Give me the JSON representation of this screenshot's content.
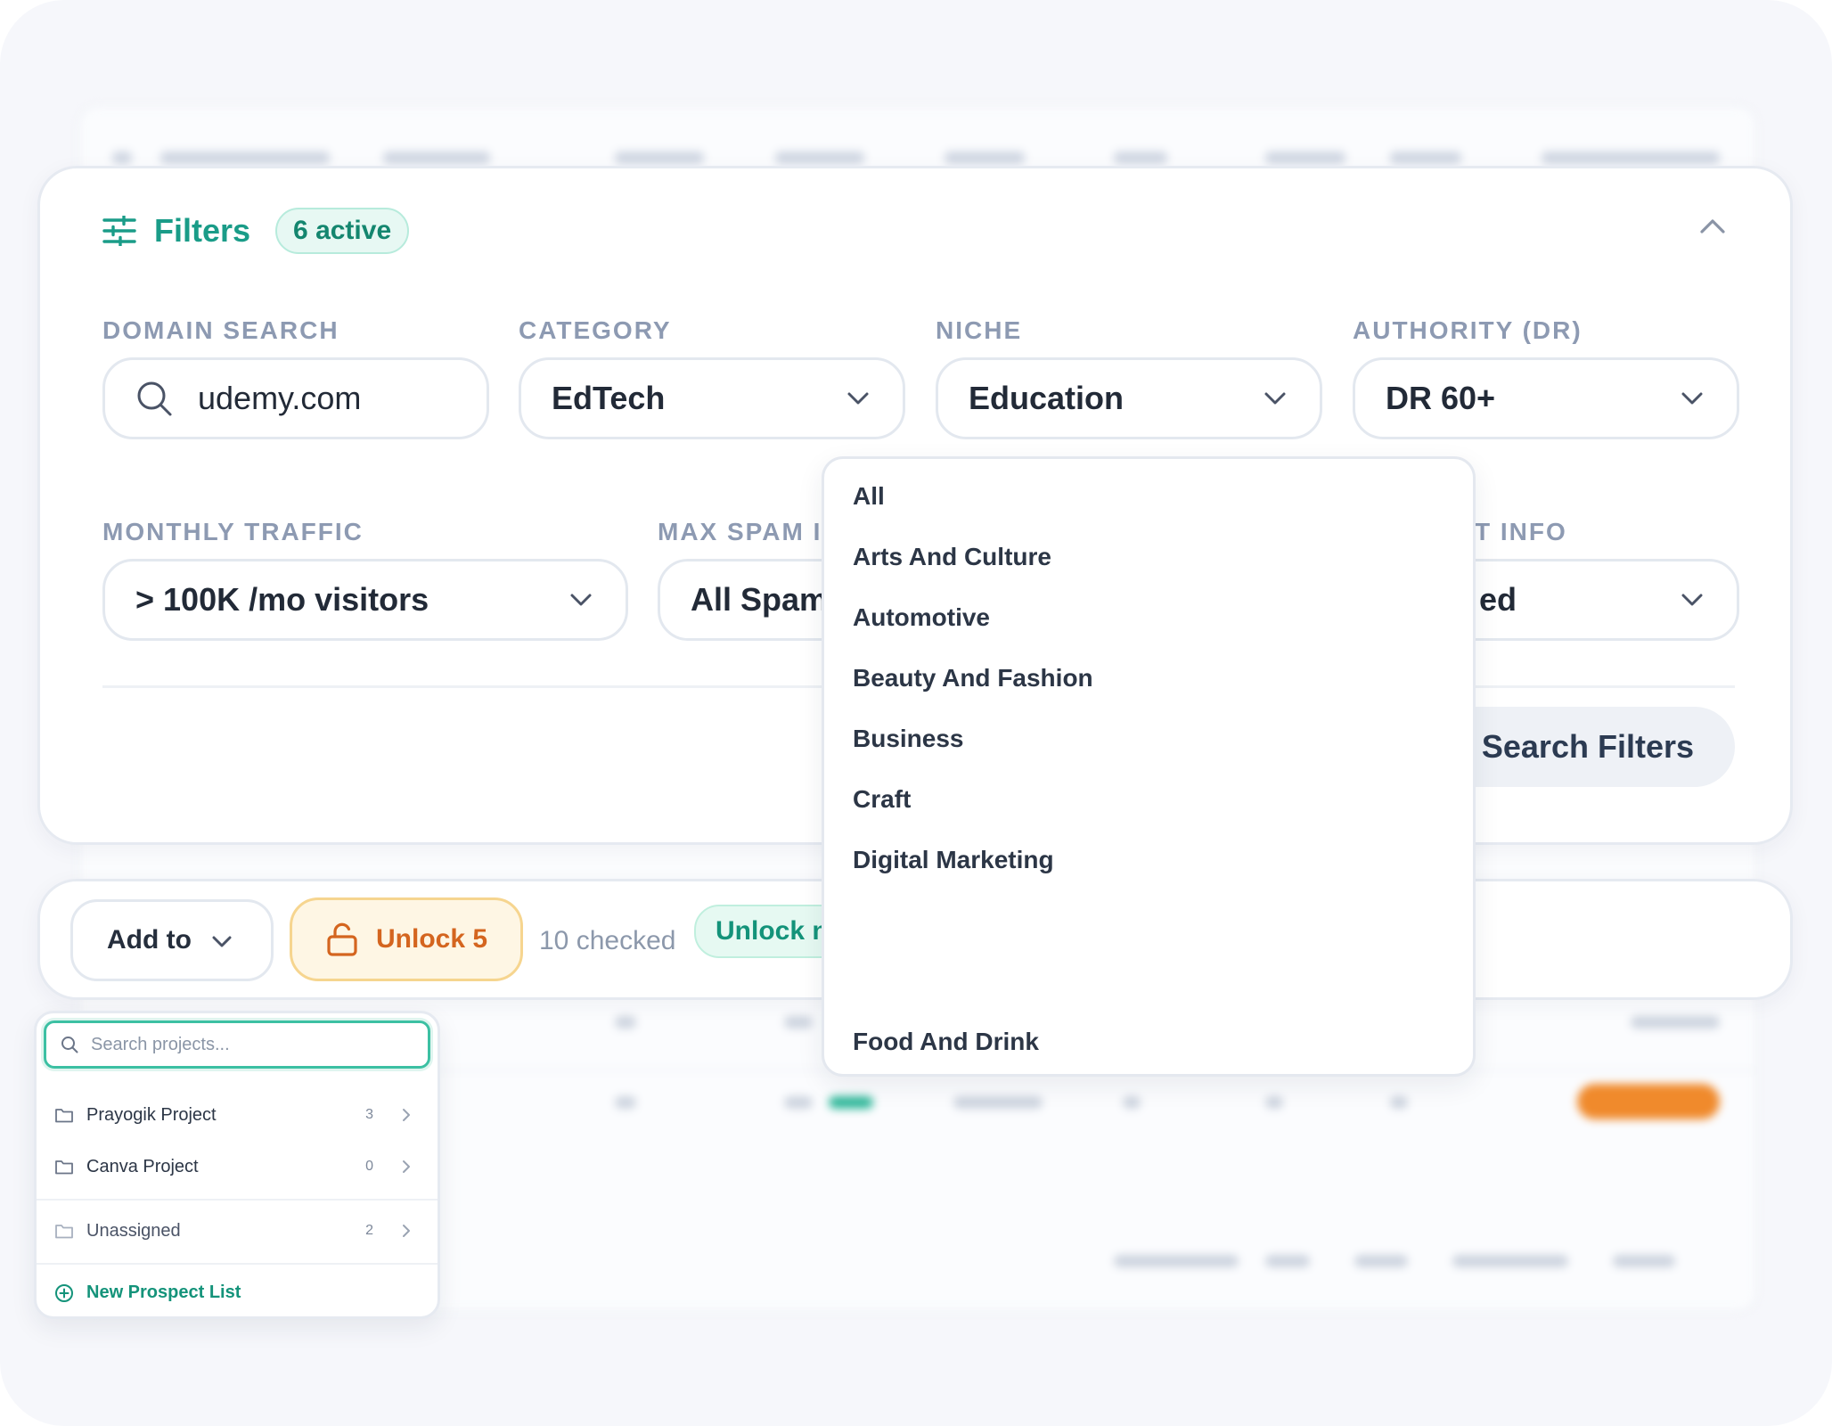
{
  "filters": {
    "title": "Filters",
    "active_badge": "6 active"
  },
  "fields": {
    "domain_search": {
      "label": "DOMAIN SEARCH",
      "value": "udemy.com"
    },
    "category": {
      "label": "CATEGORY",
      "value": "EdTech"
    },
    "niche": {
      "label": "NICHE",
      "value": "Education"
    },
    "authority": {
      "label": "AUTHORITY (DR)",
      "value": "DR 60+"
    },
    "monthly_traffic": {
      "label": "MONTHLY TRAFFIC",
      "value": "> 100K /mo visitors"
    },
    "max_spam": {
      "label": "MAX SPAM I",
      "value": "All Spam"
    },
    "contact_info": {
      "label": "T INFO",
      "value": "ed"
    }
  },
  "reset_button": "t Search Filters",
  "niche_dropdown": {
    "options": [
      "All",
      "Arts And Culture",
      "Automotive",
      "Beauty And Fashion",
      "Business",
      "Craft",
      "Digital Marketing",
      "Food And Drink"
    ]
  },
  "action_bar": {
    "add_to": "Add to",
    "unlock": "Unlock 5",
    "checked": "10 checked",
    "unlock_now": "Unlock now!"
  },
  "projects": {
    "search_placeholder": "Search projects...",
    "items": [
      {
        "name": "Prayogik Project",
        "count": "3"
      },
      {
        "name": "Canva Project",
        "count": "0"
      },
      {
        "name": "Unassigned",
        "count": "2"
      }
    ],
    "new_list": "New Prospect List"
  },
  "colors": {
    "accent": "#1a9c88",
    "unlock_orange": "#d4651f",
    "background": "#f6f7fb"
  }
}
